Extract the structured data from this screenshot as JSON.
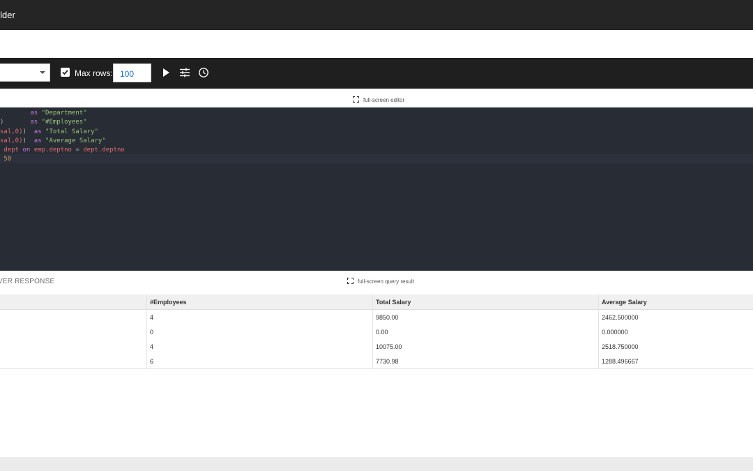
{
  "window": {
    "title": "uilder"
  },
  "toolbar": {
    "max_rows_checked": true,
    "max_rows_label": "Max rows:",
    "max_rows_value": "100",
    "icons": [
      "play-icon",
      "tune-icon",
      "history-icon"
    ]
  },
  "editor": {
    "fullscreen_label": "full-screen editor",
    "lines": [
      {
        "segments": [
          {
            "text": "        ",
            "cls": "plain"
          },
          {
            "text": "as ",
            "cls": "kw"
          },
          {
            "text": "\"Department\"",
            "cls": "str"
          }
        ]
      },
      {
        "segments": [
          {
            "text": ")",
            "cls": "plain"
          },
          {
            "text": "       ",
            "cls": "plain"
          },
          {
            "text": "as ",
            "cls": "kw"
          },
          {
            "text": "\"#Employees\"",
            "cls": "str"
          }
        ]
      },
      {
        "segments": [
          {
            "text": "sal,0)",
            "cls": "red"
          },
          {
            "text": ")  ",
            "cls": "plain"
          },
          {
            "text": "as ",
            "cls": "kw"
          },
          {
            "text": "\"Total Salary\"",
            "cls": "str"
          }
        ]
      },
      {
        "segments": [
          {
            "text": "sal,0)",
            "cls": "red"
          },
          {
            "text": ")  ",
            "cls": "plain"
          },
          {
            "text": "as ",
            "cls": "kw"
          },
          {
            "text": "\"Average Salary\"",
            "cls": "str"
          }
        ]
      },
      {
        "segments": [
          {
            "text": " dept ",
            "cls": "red"
          },
          {
            "text": "on ",
            "cls": "kw"
          },
          {
            "text": "emp.deptno ",
            "cls": "red"
          },
          {
            "text": "= ",
            "cls": "plain"
          },
          {
            "text": "dept.deptno",
            "cls": "red"
          }
        ]
      },
      {
        "segments": [
          {
            "text": " 50",
            "cls": "num"
          }
        ]
      }
    ]
  },
  "response": {
    "title": "VER RESPONSE",
    "fullscreen_label": "full-screen query result",
    "columns": [
      "",
      "#Employees",
      "Total Salary",
      "Average Salary"
    ],
    "rows": [
      [
        "",
        "4",
        "9850.00",
        "2462.500000"
      ],
      [
        "",
        "0",
        "0.00",
        "0.000000"
      ],
      [
        "",
        "4",
        "10075.00",
        "2518.750000"
      ],
      [
        "",
        "6",
        "7730.98",
        "1288.496667"
      ]
    ]
  }
}
